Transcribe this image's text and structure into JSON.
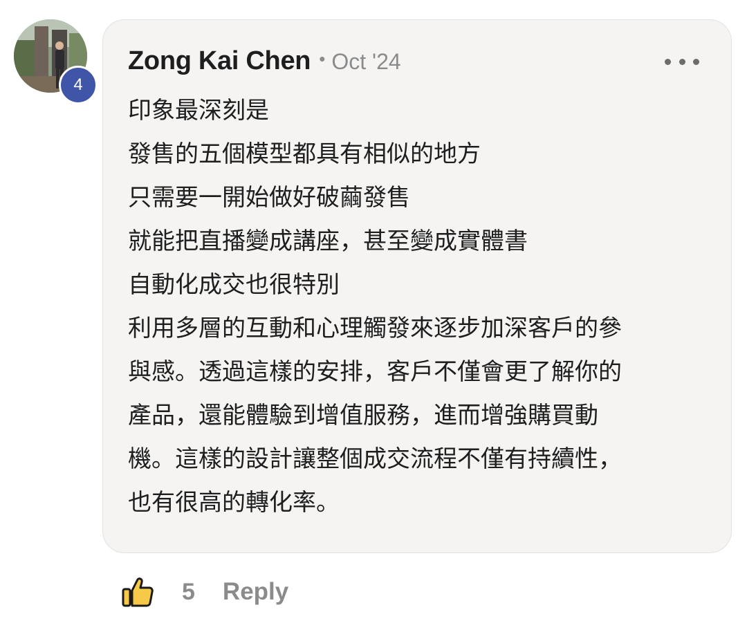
{
  "comment": {
    "author": "Zong Kai Chen",
    "separator": "•",
    "date": "Oct '24",
    "level_badge": "4",
    "lines": [
      "印象最深刻是",
      "發售的五個模型都具有相似的地方",
      "只需要一開始做好破繭發售",
      "就能把直播變成講座，甚至變成實體書",
      "自動化成交也很特別",
      "利用多層的互動和心理觸發來逐步加深客戶的參",
      "與感。透過這樣的安排，客戶不僅會更了解你的",
      "產品，還能體驗到增值服務，進而增強購買動",
      "機。這樣的設計讓整個成交流程不僅有持續性，",
      "也有很高的轉化率。"
    ]
  },
  "actions": {
    "like_icon": "thumbs-up-icon",
    "like_count": "5",
    "reply_label": "Reply"
  },
  "colors": {
    "card_background": "#f5f4f3",
    "badge": "#3f55a8",
    "muted_text": "#8b8b8b",
    "thumb_fill": "#f7c948"
  }
}
